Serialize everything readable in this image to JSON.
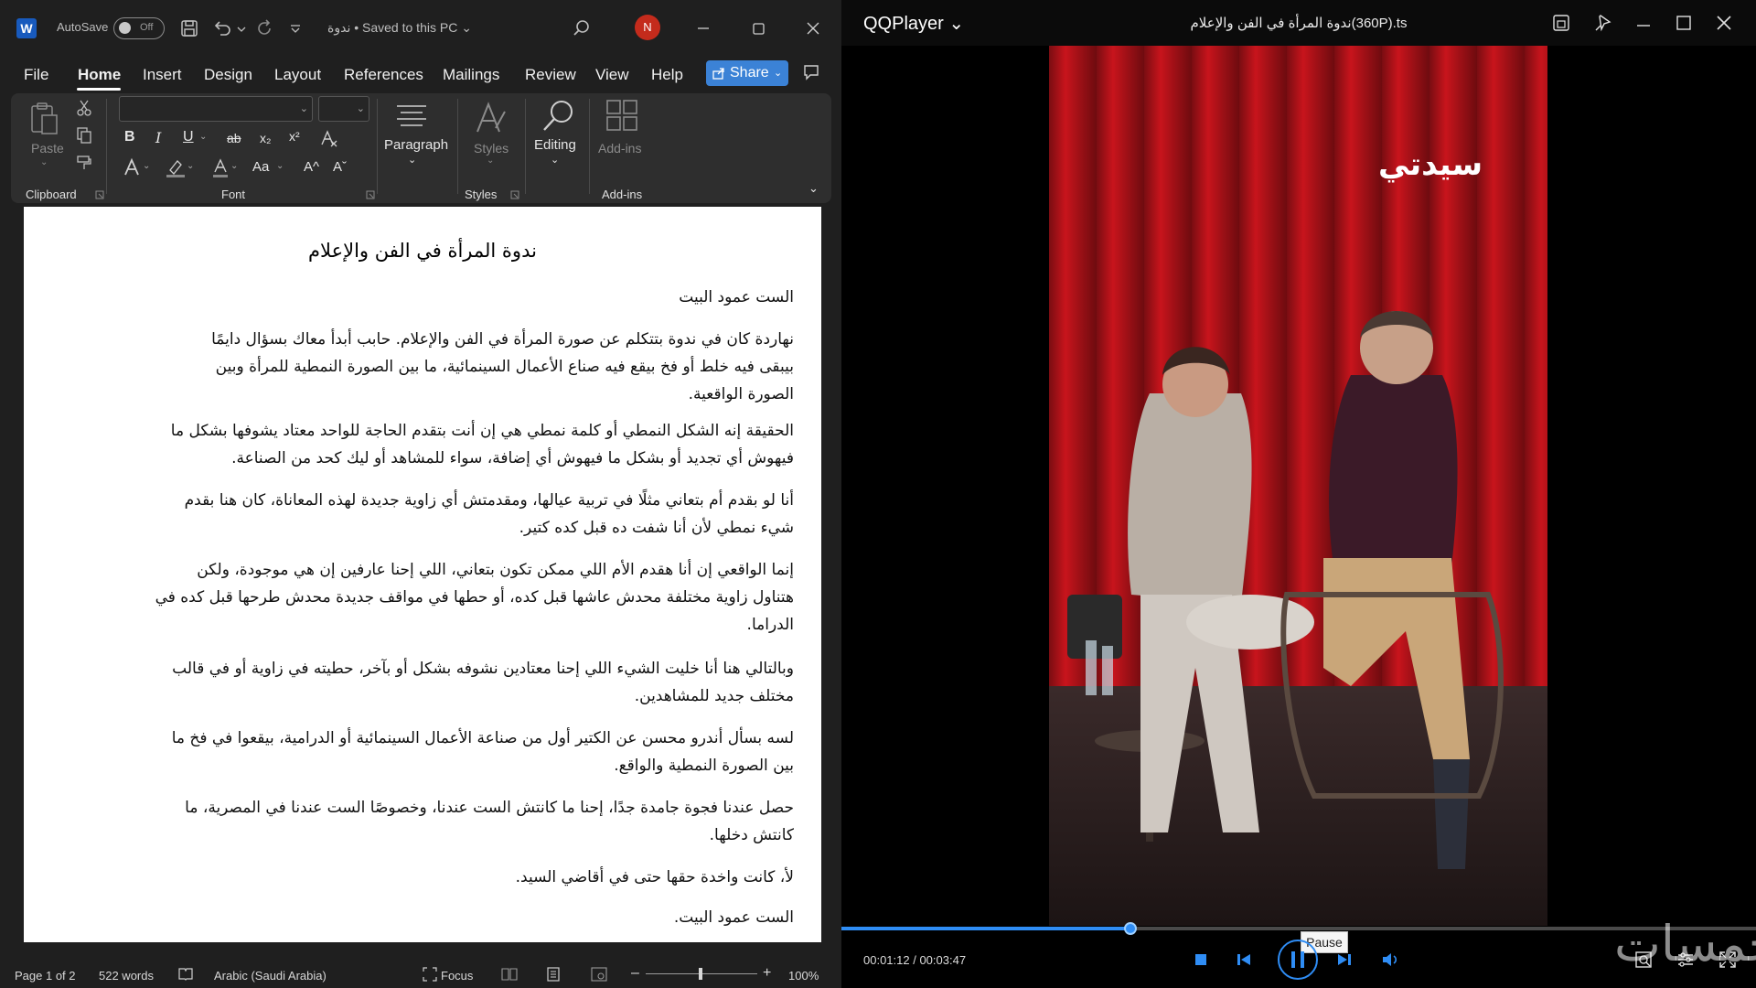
{
  "word": {
    "autosave_label": "AutoSave",
    "autosave_state": "Off",
    "doc_title": "ندوة • Saved to this PC ⌄",
    "avatar_initial": "N",
    "menu": [
      "File",
      "Home",
      "Insert",
      "Design",
      "Layout",
      "References",
      "Mailings",
      "Review",
      "View",
      "Help"
    ],
    "share_label": "Share",
    "ribbon": {
      "paste": "Paste",
      "clipboard": "Clipboard",
      "font": "Font",
      "paragraph": "Paragraph",
      "styles_btn": "Styles",
      "styles_group": "Styles",
      "editing": "Editing",
      "addins_btn": "Add-ins",
      "addins_group": "Add-ins",
      "bold": "B",
      "italic": "I",
      "underline": "U",
      "strike": "ab",
      "sub": "x₂",
      "sup": "x²",
      "case": "Aa",
      "grow": "A^",
      "shrink": "Aˇ"
    },
    "document": {
      "title": "ندوة المرأة في الفن والإعلام",
      "paragraphs": [
        "الست عمود البيت",
        "نهاردة كان في ندوة بتتكلم عن صورة المرأة في الفن والإعلام. حابب أبدأ معاك بسؤال دايمًا بيبقى فيه خلط أو فخ بيقع فيه صناع الأعمال السينمائية، ما بين الصورة النمطية للمرأة وبين الصورة الواقعية.",
        "الحقيقة إنه الشكل النمطي أو كلمة نمطي هي إن أنت بتقدم الحاجة للواحد معتاد يشوفها بشكل ما فيهوش أي تجديد أو بشكل ما فيهوش أي إضافة، سواء للمشاهد أو ليك كحد من الصناعة.",
        "أنا لو بقدم أم بتعاني مثلًا في تربية عيالها، ومقدمتش أي زاوية جديدة لهذه المعاناة، كان هنا بقدم شيء نمطي لأن أنا شفت ده قبل كده كتير.",
        "إنما الواقعي إن أنا هقدم الأم اللي ممكن تكون بتعاني، اللي إحنا عارفين إن هي موجودة، ولكن هتناول زاوية مختلفة محدش عاشها قبل كده، أو حطها في مواقف جديدة محدش طرحها قبل كده في الدراما.",
        "وبالتالي هنا أنا خليت الشيء اللي إحنا معتادين نشوفه بشكل أو بآخر، حطيته في زاوية أو في قالب مختلف جديد للمشاهدين.",
        "لسه بسأل أندرو محسن عن الكتير أول من صناعة الأعمال السينمائية أو الدرامية، بيقعوا في فخ ما بين الصورة النمطية والواقع.",
        "حصل عندنا فجوة جامدة جدًا، إحنا ما كانتش الست عندنا، وخصوصًا الست عندنا في المصرية، ما كانتش دخلها.",
        "لأ، كانت واخدة حقها حتى في أقاضي السيد.",
        "الست عمود البيت."
      ]
    },
    "status": {
      "page": "Page 1 of 2",
      "words": "522 words",
      "language": "Arabic (Saudi Arabia)",
      "focus": "Focus",
      "zoom": "100%"
    }
  },
  "player": {
    "app_name": "QQPlayer ⌄",
    "file_title": "ندوة المرأة في الفن والإعلام(360P).ts",
    "video_watermark": "سيدتي",
    "time": "00:01:12 / 00:03:47",
    "tooltip": "Pause",
    "progress_fraction": 0.317,
    "brand_watermark": "خمسات",
    "accent_color": "#2f8df5"
  }
}
